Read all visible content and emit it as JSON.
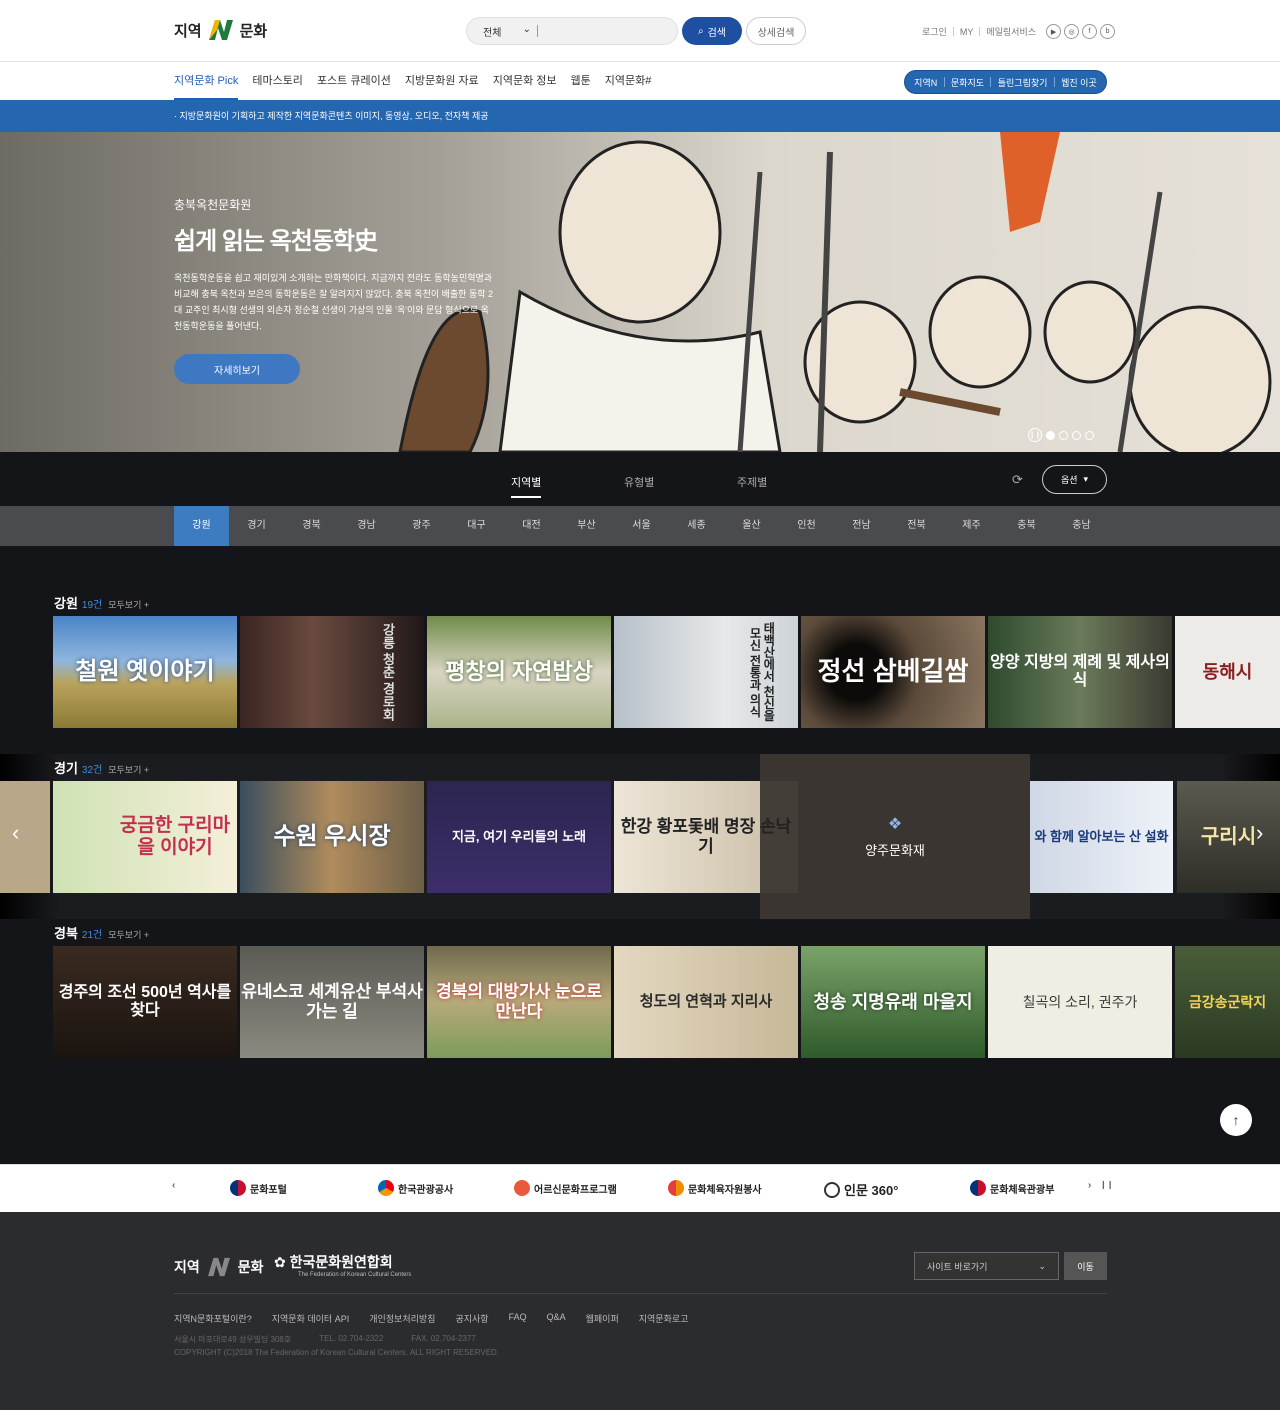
{
  "header": {
    "logo_left": "지역",
    "logo_right": "문화",
    "search_scope": "전체",
    "search_btn": "검색",
    "adv_btn": "상세검색",
    "util": [
      "로그인",
      "MY",
      "메일링서비스"
    ],
    "sns": [
      "▶",
      "◎",
      "f",
      "b"
    ]
  },
  "gnb": {
    "items": [
      "지역문화 Pick",
      "테마스토리",
      "포스트 큐레이션",
      "지방문화원 자료",
      "지역문화 정보",
      "웹툰",
      "지역문화#"
    ],
    "quick": [
      "지역N",
      "문화지도",
      "틀린그림찾기",
      "웹진 이곳"
    ]
  },
  "notice": "지방문화원이 기획하고 제작한 지역문화콘텐츠 이미지, 동영상, 오디오, 전자책 제공",
  "hero": {
    "sub": "충북옥천문화원",
    "title": "쉽게 읽는 옥천동학史",
    "desc": "옥천동학운동을 쉽고 재미있게 소개하는 만화책이다. 지금까지 전라도 동학농민혁명과 비교해 충북 옥천과 보은의 동학운동은 잘 알려지지 않았다. 충북 옥천이 배출한 동학 2대 교주인 최시형 선생의 외손자 정순철 선생이 가상의 인물 '옥'이와 문답 형식으로 옥천동학운동을 풀어낸다.",
    "btn": "자세히보기"
  },
  "tabs": {
    "items": [
      "지역별",
      "유형별",
      "주제별"
    ],
    "option": "옵션"
  },
  "regions": [
    "강원",
    "경기",
    "경북",
    "경남",
    "광주",
    "대구",
    "대전",
    "부산",
    "서울",
    "세종",
    "울산",
    "인천",
    "전남",
    "전북",
    "제주",
    "충북",
    "충남"
  ],
  "sections": [
    {
      "name": "강원",
      "count": "19건",
      "more": "모두보기 +",
      "cards": [
        "철원 옛이야기",
        "강릉 청춘 경로회",
        "평창의 자연밥상",
        "태백산에서 천신을 모신 전통과 의식",
        "정선 삼베길쌈",
        "양양 지방의 제례 및 제사의 식",
        "동해시"
      ]
    },
    {
      "name": "경기",
      "count": "32건",
      "more": "모두보기 +",
      "cards": [
        "궁금한 구리마을 이야기",
        "수원 우시장",
        "지금, 여기 우리들의 노래",
        "한강 황포돛배 명장 손낙기",
        "양주문화재",
        "와 함께 알아보는 산 설화",
        "구리시"
      ],
      "hover": "양주문화재"
    },
    {
      "name": "경북",
      "count": "21건",
      "more": "모두보기 +",
      "cards": [
        "경주의 조선 500년 역사를 찾다",
        "유네스코 세계유산 부석사 가는 길",
        "경북의 대방가사 눈으로 만난다",
        "청도의 연혁과 지리사",
        "청송 지명유래 마을지",
        "칠곡의 소리, 권주가",
        "금강송군락지"
      ]
    }
  ],
  "partners": [
    "문화포털",
    "한국관광공사",
    "어르신문화프로그램",
    "문화체육자원봉사",
    "인문 360°",
    "문화체육관광부"
  ],
  "footer": {
    "logo_left": "지역",
    "logo_right": "문화",
    "kfcc": "한국문화원연합회",
    "kfcc_en": "The Federation of Korean Cultural Centers",
    "site_select": "사이트 바로가기",
    "go": "이동",
    "links": [
      "지역N문화포털이란?",
      "지역문화 데이터 API",
      "개인정보처리방침",
      "공지사항",
      "FAQ",
      "Q&A",
      "웹페이퍼",
      "지역문화로고"
    ],
    "addr": "서울시 마포대로49 성우빌딩 308호",
    "tel": "TEL. 02.704-2322",
    "fax": "FAX. 02.704-2377",
    "copy": "COPYRIGHT (C)2018 The Federation of Korean Cultural Centers. ALL RIGHT RESERVED."
  }
}
